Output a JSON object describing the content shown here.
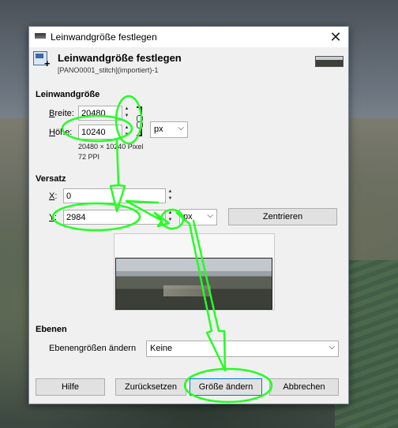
{
  "window": {
    "title": "Leinwandgröße festlegen",
    "close_glyph": "✕"
  },
  "header": {
    "title": "Leinwandgröße festlegen",
    "subtitle": "[PANO0001_stitch](importiert)-1"
  },
  "canvas_size": {
    "section": "Leinwandgröße",
    "width_label_key": "B",
    "width_label_rest": "reite:",
    "width_value": "20480",
    "height_label_key": "H",
    "height_label_rest": "öhe:",
    "height_value": "10240",
    "unit": "px",
    "size_info": "20480 × 10240 Pixel",
    "ppi_info": "72 PPI"
  },
  "offset": {
    "section": "Versatz",
    "x_label_key": "X",
    "x_label_rest": ":",
    "x_value": "0",
    "y_label_key": "Y",
    "y_label_rest": ":",
    "y_value": "2984",
    "unit": "px",
    "center_button": "Zentrieren"
  },
  "layers": {
    "section": "Ebenen",
    "resize_label": "Ebenengrößen ändern",
    "resize_value": "Keine"
  },
  "buttons": {
    "help": "Hilfe",
    "reset": "Zurücksetzen",
    "resize": "Größe ändern",
    "cancel": "Abbrechen"
  },
  "icons": {
    "chain": "chain-link-icon",
    "spin_up": "▲",
    "spin_down": "▼",
    "combo_arrow": "⌵"
  },
  "colors": {
    "annotation": "#22ff22",
    "dialog_bg": "#f0f0f0",
    "accent": "#0078d7"
  }
}
